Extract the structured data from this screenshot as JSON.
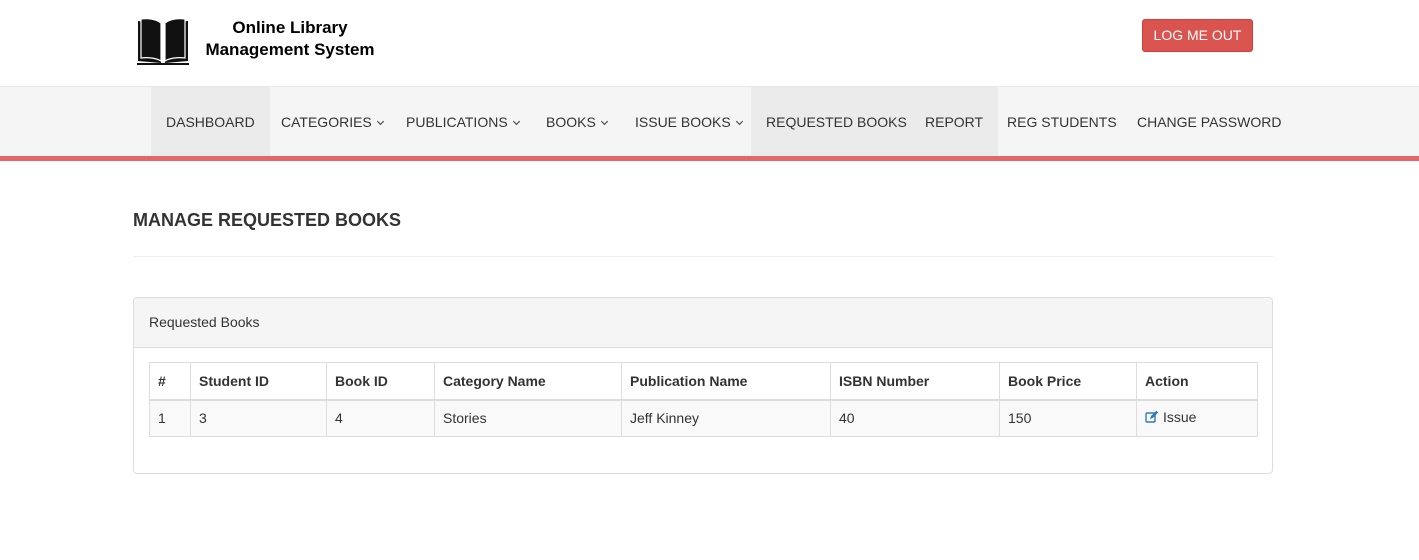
{
  "brand": {
    "line1": "Online Library",
    "line2": "Management System",
    "logo_icon": "open-book-icon"
  },
  "header": {
    "logout_label": "LOG ME OUT"
  },
  "nav": {
    "items": [
      {
        "label": "DASHBOARD",
        "dropdown": false,
        "active": true
      },
      {
        "label": "CATEGORIES",
        "dropdown": true,
        "active": false
      },
      {
        "label": "PUBLICATIONS",
        "dropdown": true,
        "active": false
      },
      {
        "label": "BOOKS",
        "dropdown": true,
        "active": false
      },
      {
        "label": "ISSUE BOOKS",
        "dropdown": true,
        "active": false
      },
      {
        "label": "REQUESTED BOOKS",
        "dropdown": false,
        "active": true
      },
      {
        "label": "REPORT",
        "dropdown": false,
        "active": true
      },
      {
        "label": "REG STUDENTS",
        "dropdown": false,
        "active": false
      },
      {
        "label": "CHANGE PASSWORD",
        "dropdown": false,
        "active": false
      }
    ],
    "accent_color": "#e3686a"
  },
  "page": {
    "title": "MANAGE REQUESTED BOOKS"
  },
  "panel": {
    "heading": "Requested Books",
    "table": {
      "columns": [
        "#",
        "Student ID",
        "Book ID",
        "Category Name",
        "Publication Name",
        "ISBN Number",
        "Book Price",
        "Action"
      ],
      "rows": [
        {
          "cells": [
            "1",
            "3",
            "4",
            "Stories",
            "Jeff Kinney",
            "40",
            "150"
          ],
          "action_label": "Issue",
          "action_icon": "edit-icon"
        }
      ]
    }
  },
  "colors": {
    "logout_bg": "#d9534f",
    "link_icon": "#337ab7"
  }
}
